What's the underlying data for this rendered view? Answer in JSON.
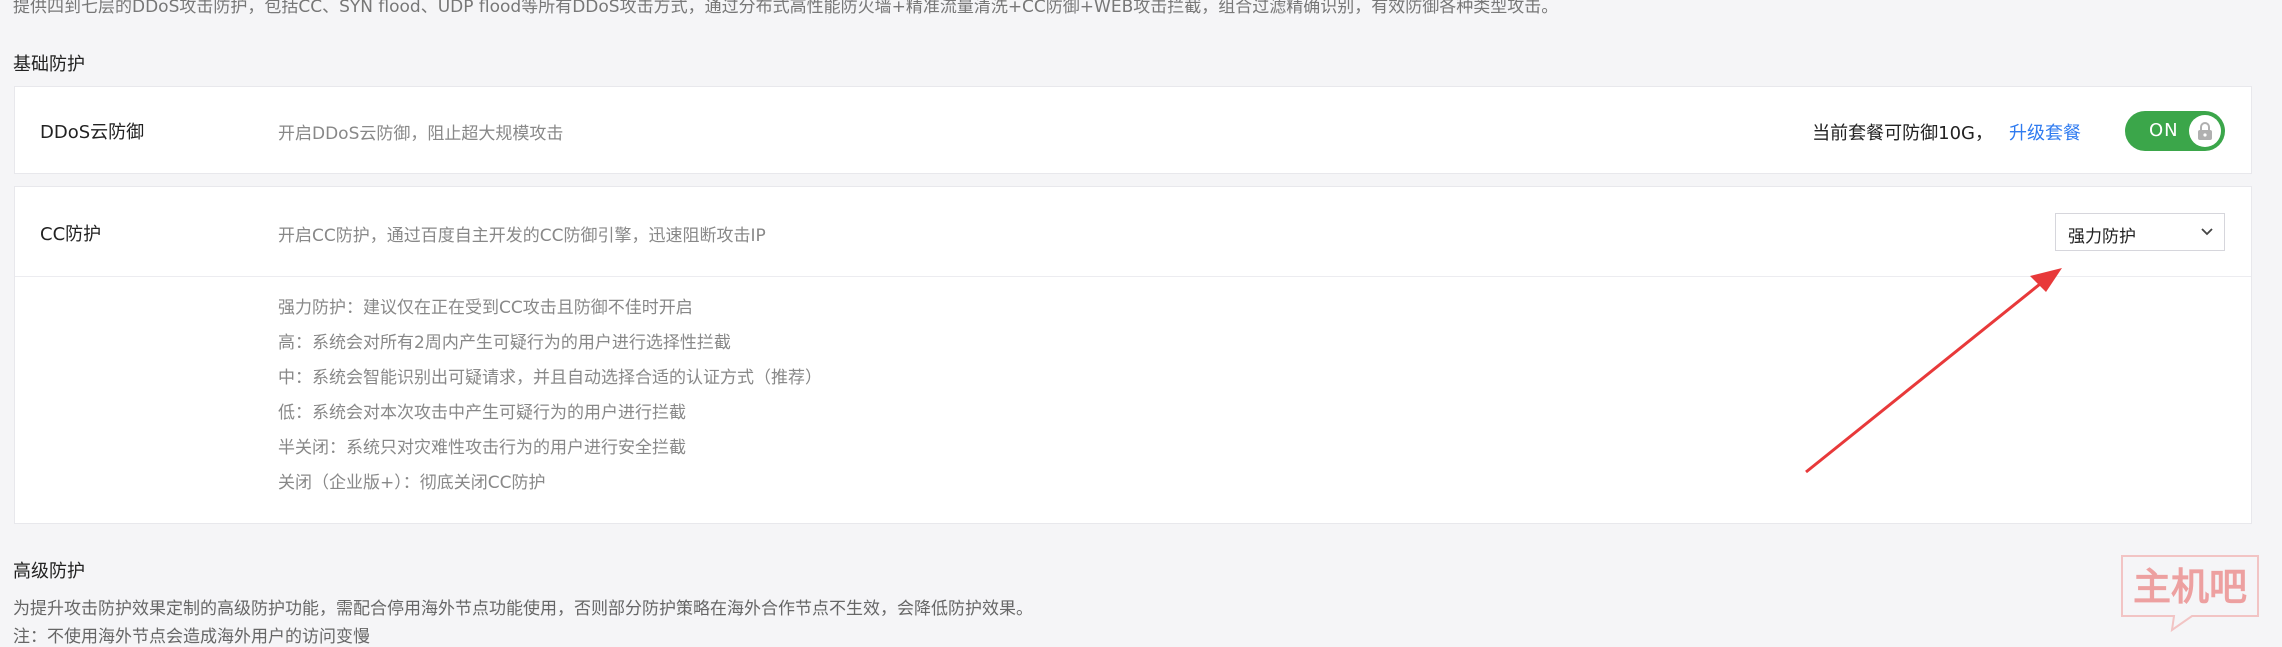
{
  "top": {
    "description": "提供四到七层的DDoS攻击防护，包括CC、SYN flood、UDP flood等所有DDoS攻击方式，通过分布式高性能防火墙+精准流量清洗+CC防御+WEB攻击拦截，组合过滤精确识别，有效防御各种类型攻击。"
  },
  "basic": {
    "title": "基础防护",
    "ddos": {
      "label": "DDoS云防御",
      "description": "开启DDoS云防御，阻止超大规模攻击",
      "plan_text": "当前套餐可防御10G，",
      "upgrade_link": "升级套餐",
      "toggle_label": "ON",
      "enabled": true
    },
    "cc": {
      "label": "CC防护",
      "description": "开启CC防护，通过百度自主开发的CC防御引擎，迅速阻断攻击IP",
      "selected_level": "强力防护",
      "options": [
        "强力防护：建议仅在正在受到CC攻击且防御不佳时开启",
        "高：系统会对所有2周内产生可疑行为的用户进行选择性拦截",
        "中：系统会智能识别出可疑请求，并且自动选择合适的认证方式（推荐）",
        "低：系统会对本次攻击中产生可疑行为的用户进行拦截",
        "半关闭：系统只对灾难性攻击行为的用户进行安全拦截",
        "关闭（企业版+）：彻底关闭CC防护"
      ]
    }
  },
  "advanced": {
    "title": "高级防护",
    "description": "为提升攻击防护效果定制的高级防护功能，需配合停用海外节点功能使用，否则部分防护策略在海外合作节点不生效，会降低防护效果。",
    "note": "注：不使用海外节点会造成海外用户的访问变慢"
  },
  "colors": {
    "toggle_on": "#3ba64a",
    "link": "#2f7bf0",
    "arrow": "#e8393a",
    "watermark": "#e86060"
  },
  "watermark": {
    "text": "主机吧"
  }
}
